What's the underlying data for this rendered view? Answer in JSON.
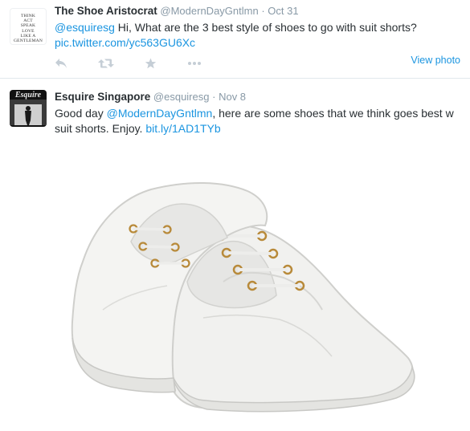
{
  "tweets": [
    {
      "name": "The Shoe Aristocrat",
      "handle": "@ModernDayGntlmn",
      "separator": "·",
      "time": "Oct 31",
      "mention": "@esquiresg",
      "text": " Hi, What are the 3 best style of shoes to go with suit shorts?",
      "link": "pic.twitter.com/yc563GU6Xc",
      "view_photo_label": "View photo",
      "avatar_lines": [
        "THINK",
        "ACT",
        "SPEAK",
        "LOVE",
        "LIKE A",
        "GENTLEMAN"
      ],
      "actions": [
        "reply-icon",
        "retweet-icon",
        "favorite-icon",
        "more-icon"
      ]
    },
    {
      "name": "Esquire Singapore",
      "handle": "@esquiresg",
      "separator": "·",
      "time": "Nov 8",
      "text_before": "Good day ",
      "mention": "@ModernDayGntlmn",
      "text_after": ", here are some shoes that we think goes best w suit shorts. Enjoy. ",
      "link": "bit.ly/1AD1TYb",
      "avatar_logo": "Esquire",
      "photo_alt": "white canvas lace-up sneakers"
    }
  ],
  "colors": {
    "link": "#1b95e0",
    "meta": "#8899a6",
    "text": "#292f33",
    "icon": "#c5ced6"
  }
}
